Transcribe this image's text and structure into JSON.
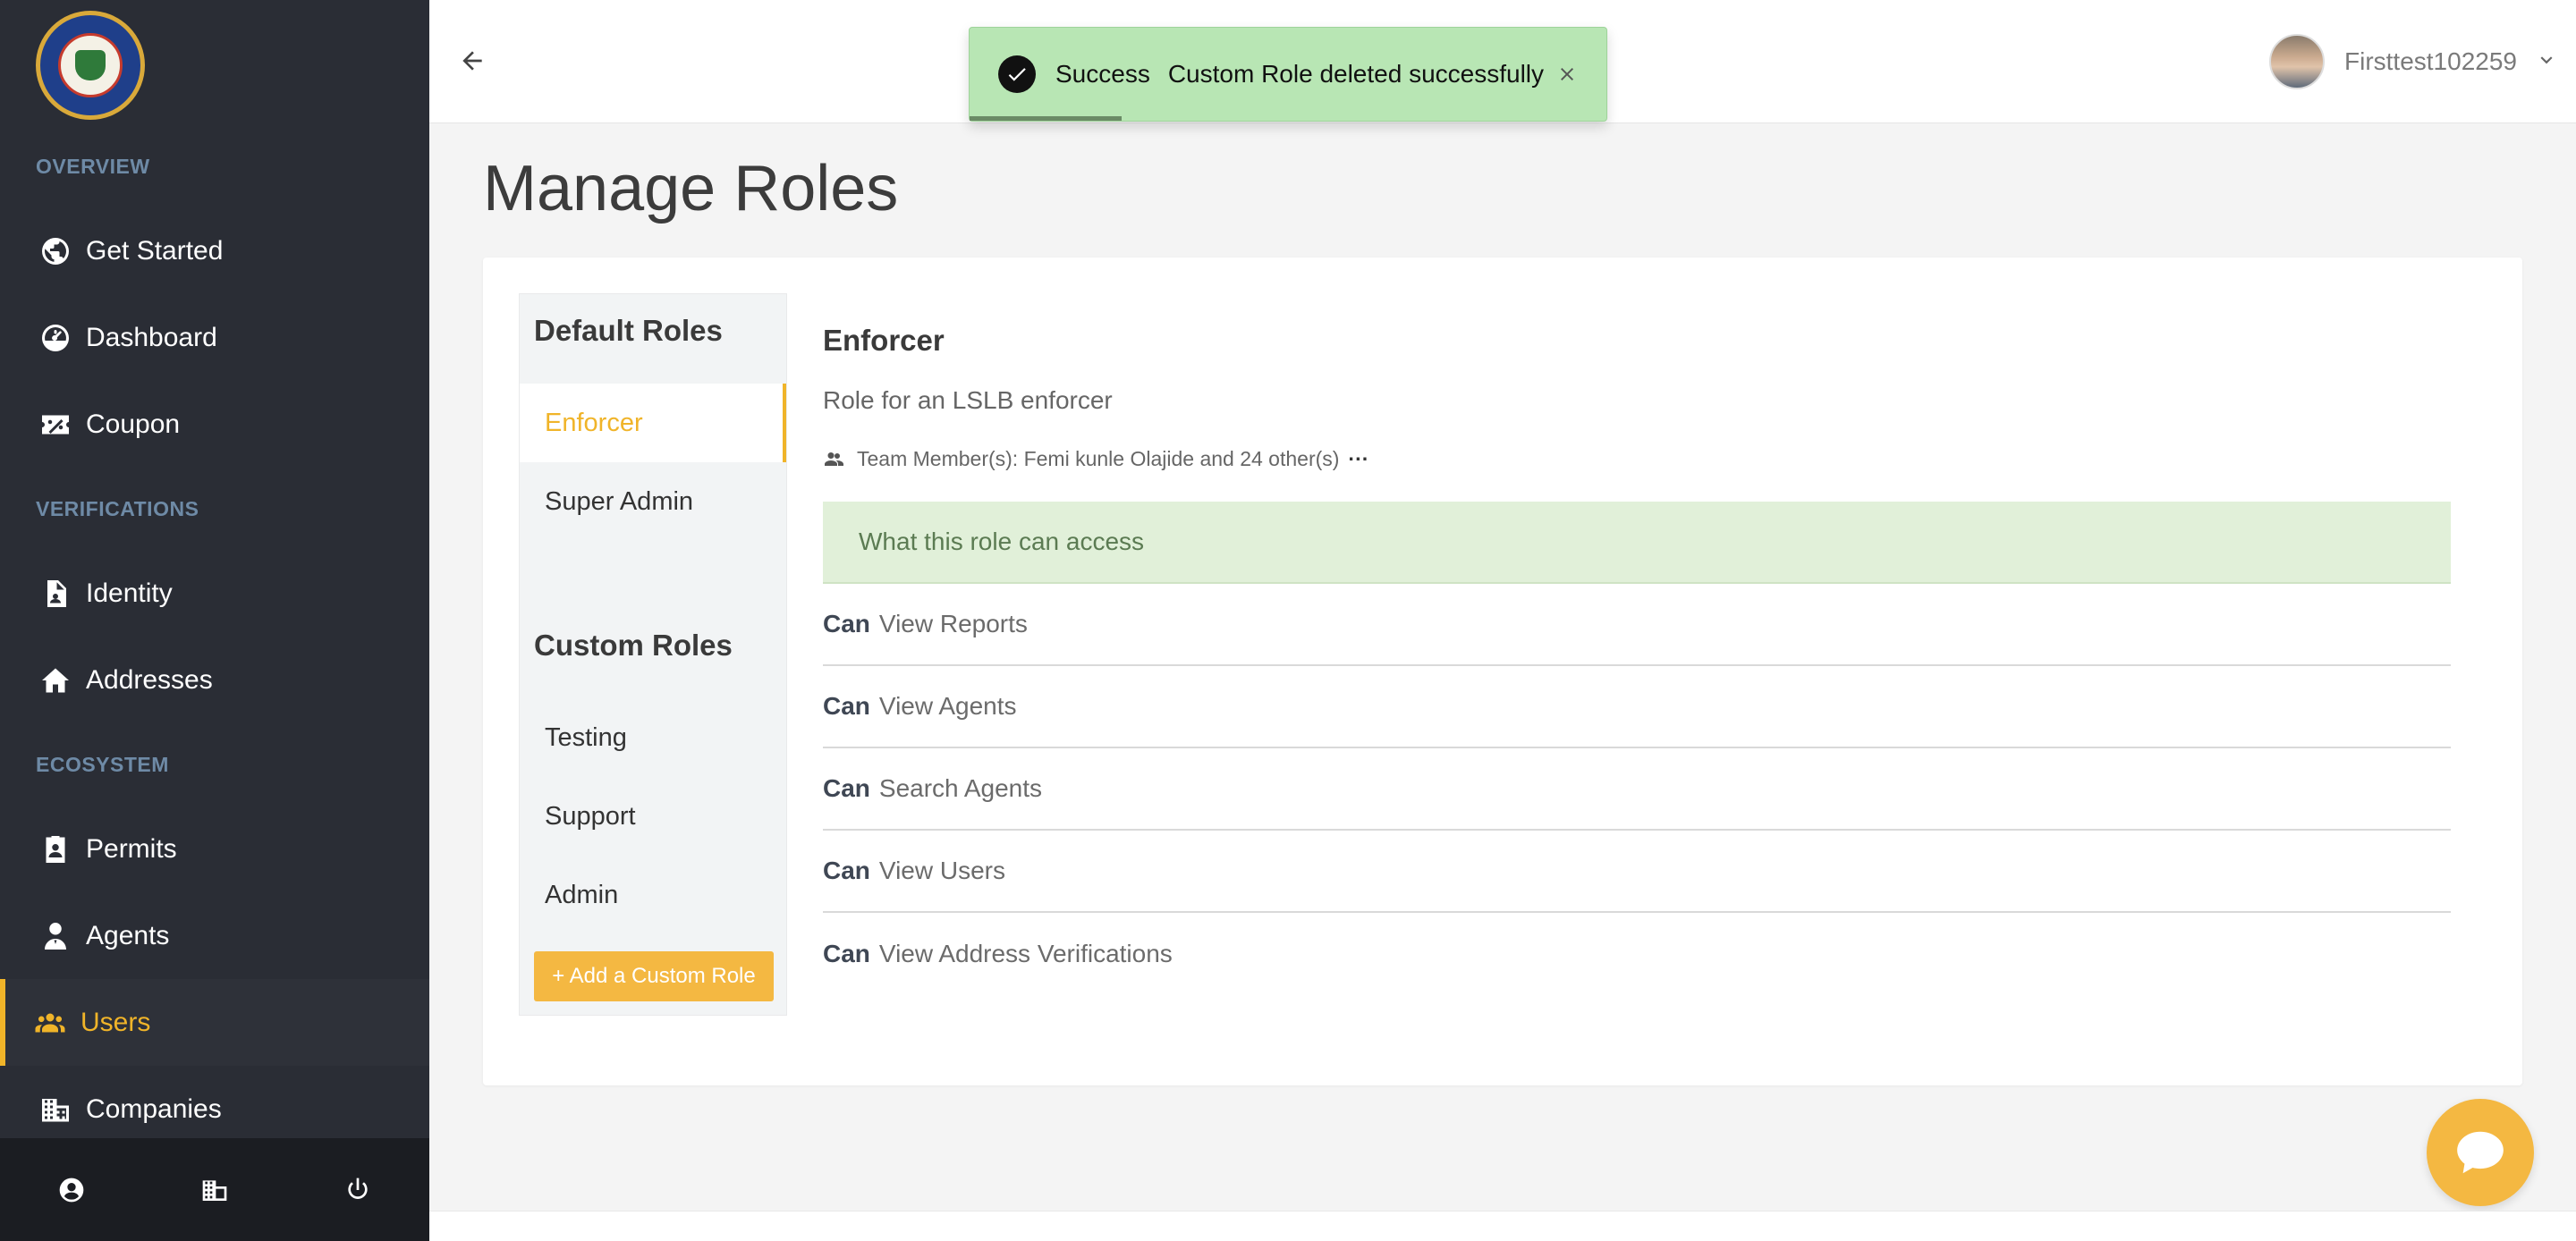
{
  "sidebar": {
    "sections": {
      "overview": "OVERVIEW",
      "verifications": "VERIFICATIONS",
      "ecosystem": "ECOSYSTEM"
    },
    "items": {
      "get_started": "Get Started",
      "dashboard": "Dashboard",
      "coupon": "Coupon",
      "identity": "Identity",
      "addresses": "Addresses",
      "permits": "Permits",
      "agents": "Agents",
      "users": "Users",
      "companies": "Companies"
    },
    "active_item": "Users",
    "accent_color": "#f0b429"
  },
  "topbar": {
    "user_name": "Firsttest102259"
  },
  "toast": {
    "title": "Success",
    "message": "Custom Role deleted successfully",
    "background": "#b8e6b4"
  },
  "page": {
    "title": "Manage Roles"
  },
  "roles": {
    "default_heading": "Default Roles",
    "default_items": [
      "Enforcer",
      "Super Admin"
    ],
    "custom_heading": "Custom Roles",
    "custom_items": [
      "Testing",
      "Support",
      "Admin"
    ],
    "add_button": "+ Add a Custom Role",
    "selected": "Enforcer"
  },
  "detail": {
    "title": "Enforcer",
    "description": "Role for an LSLB enforcer",
    "team_members": "Team Member(s): Femi kunle Olajide and 24 other(s)",
    "more": "···",
    "access_heading": "What this role can access",
    "can_label": "Can",
    "permissions": [
      "View Reports",
      "View Agents",
      "Search Agents",
      "View Users",
      "View Address Verifications"
    ]
  },
  "icons": {
    "chat": "chat-icon",
    "back": "arrow-left-icon"
  }
}
